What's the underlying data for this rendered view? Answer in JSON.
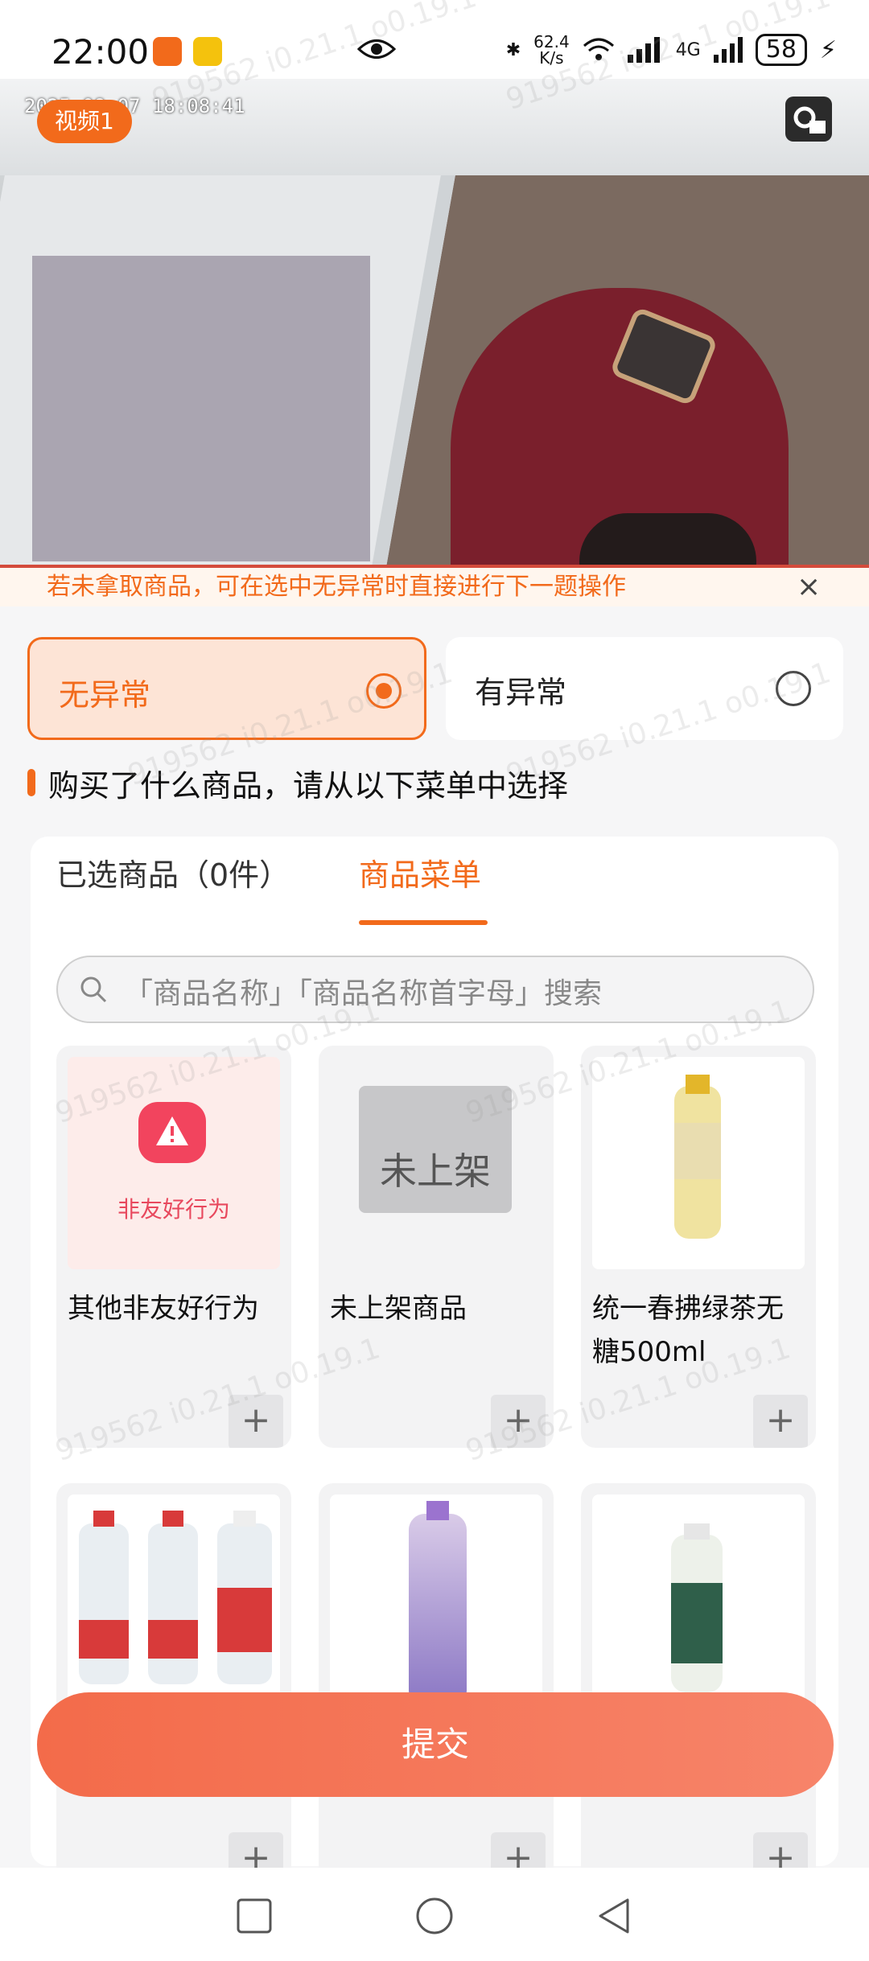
{
  "status_bar": {
    "time": "22:00",
    "net_speed_value": "62.4",
    "net_speed_unit": "K/s",
    "network_type": "4G",
    "battery": "58"
  },
  "video": {
    "tag": "视频1",
    "timestamp": "2025-08-07 18:08:41"
  },
  "tip": {
    "text": "若未拿取商品，可在选中无异常时直接进行下一题操作",
    "close": "×"
  },
  "choices": {
    "normal": "无异常",
    "abnormal": "有异常",
    "selected": "normal"
  },
  "section_title": "购买了什么商品，请从以下菜单中选择",
  "tabs": {
    "selected_products": "已选商品（0件）",
    "product_menu": "商品菜单"
  },
  "search": {
    "placeholder": "「商品名称」「商品名称首字母」搜索"
  },
  "products": [
    {
      "name": "其他非友好行为",
      "image_label": "非友好行为",
      "add": "+"
    },
    {
      "name": "未上架商品",
      "image_label": "未上架",
      "add": "+"
    },
    {
      "name": "统一春拂绿茶无糖500ml",
      "add": "+"
    },
    {
      "name": "",
      "add": "+"
    },
    {
      "name": "",
      "add": "+"
    },
    {
      "name": "",
      "add": "+"
    }
  ],
  "submit": "提交",
  "watermark": "919562 i0.21.1 o0.19.1",
  "colors": {
    "accent": "#f26a1b",
    "selected_bg": "#fde4d6",
    "submit": "#f36b4a"
  }
}
